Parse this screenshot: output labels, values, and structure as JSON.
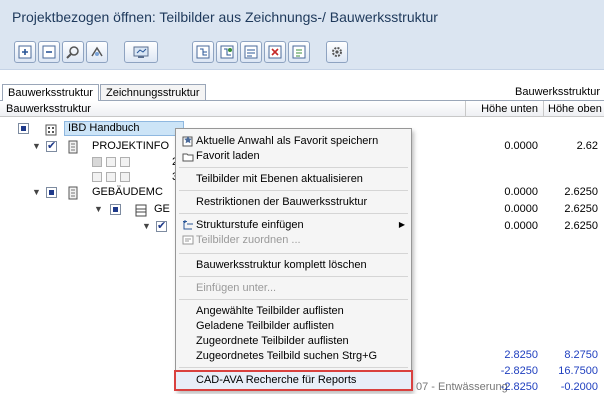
{
  "window": {
    "title": "Projektbezogen öffnen: Teilbilder aus Zeichnungs-/ Bauwerksstruktur"
  },
  "toolbar": {
    "buttons": [
      {
        "icon": "expand-tree-icon"
      },
      {
        "icon": "collapse-tree-icon"
      },
      {
        "icon": "search-icon"
      },
      {
        "icon": "filter-icon"
      },
      {
        "icon": "view-icon"
      },
      {
        "icon": "structure-add-icon"
      },
      {
        "icon": "structure-edit-icon"
      },
      {
        "icon": "structure-move-icon"
      },
      {
        "icon": "structure-delete-icon"
      },
      {
        "icon": "structure-properties-icon"
      },
      {
        "icon": "settings-icon"
      }
    ]
  },
  "tabs": {
    "building": "Bauwerksstruktur",
    "drawing": "Zeichnungsstruktur",
    "right_label": "Bauwerksstruktur"
  },
  "columns": {
    "name": "Bauwerksstruktur",
    "lower": "Höhe unten",
    "upper": "Höhe oben"
  },
  "tree": {
    "root": "IBD Handbuch",
    "project_info": "PROJEKTINFO",
    "pi_child_1_num": "2",
    "pi_child_2_num": "3",
    "building": "GEBÄUDEMC",
    "storey": "GE",
    "bottom_label": "07 - Entwässerung"
  },
  "values": {
    "r1_lower": "0.0000",
    "r1_upper": "2.62",
    "r2_lower": "0.0000",
    "r2_upper": "2.6250",
    "r3_lower": "0.0000",
    "r3_upper": "2.6250",
    "r4_lower": "0.0000",
    "r4_upper": "2.6250",
    "r5_lower": "2.8250",
    "r5_upper": "8.2750",
    "r6_lower": "-2.8250",
    "r6_upper": "16.7500",
    "r7_lower": "-2.8250",
    "r7_upper": "-0.2000"
  },
  "context_menu": {
    "items": [
      "Aktuelle Anwahl als Favorit speichern",
      "Favorit laden",
      "Teilbilder mit Ebenen aktualisieren",
      "Restriktionen der Bauwerksstruktur",
      "Strukturstufe einfügen",
      "Teilbilder zuordnen ...",
      "Bauwerksstruktur komplett löschen",
      "Einfügen unter...",
      "Angewählte Teilbilder auflisten",
      "Geladene Teilbilder auflisten",
      "Zugeordnete Teilbilder auflisten",
      "Zugeordnetes Teilbild suchen Strg+G",
      "CAD-AVA Recherche für Reports"
    ]
  },
  "colors": {
    "header_bg": "#dbe5f1",
    "highlight_border": "#d9413f",
    "value_blue": "#1f3fbf"
  }
}
